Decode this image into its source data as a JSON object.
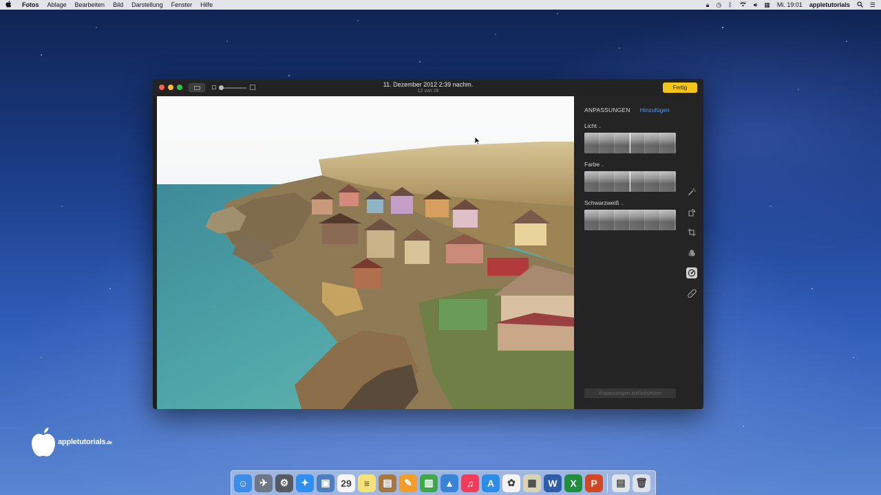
{
  "menubar": {
    "apple": "",
    "items": [
      "Fotos",
      "Ablage",
      "Bearbeiten",
      "Bild",
      "Darstellung",
      "Fenster",
      "Hilfe"
    ],
    "clock": "Mi. 19:01",
    "user": "appletutorials"
  },
  "window": {
    "title": "11. Dezember 2012 2:39 nachm.",
    "subtitle": "12 von 28",
    "done_label": "Fertig"
  },
  "panel": {
    "tab_adjust": "ANPASSUNGEN",
    "tab_add": "Hinzufügen",
    "sections": [
      {
        "label": "Licht",
        "marker": true
      },
      {
        "label": "Farbe",
        "marker": true
      },
      {
        "label": "Schwarzweiß",
        "marker": false
      }
    ],
    "reset_label": "Anpassungen zurücksetzen"
  },
  "tools": [
    "magic-wand-icon",
    "rotate-icon",
    "crop-icon",
    "filters-icon",
    "adjust-icon",
    "retouch-icon"
  ],
  "logo": {
    "text": "appletutorials",
    "suffix": ".de"
  },
  "dock": {
    "items": [
      {
        "name": "finder-icon",
        "color": "#3d8de8",
        "glyph": "☺"
      },
      {
        "name": "launchpad-icon",
        "color": "#6d7785",
        "glyph": "✈"
      },
      {
        "name": "system-preferences-icon",
        "color": "#555b63",
        "glyph": "⚙"
      },
      {
        "name": "safari-icon",
        "color": "#2e8ff0",
        "glyph": "✦"
      },
      {
        "name": "preview-icon",
        "color": "#4d7fbf",
        "glyph": "▣"
      },
      {
        "name": "calendar-icon",
        "color": "#f6f6f6",
        "glyph": "29"
      },
      {
        "name": "notes-icon",
        "color": "#f5e27a",
        "glyph": "≡"
      },
      {
        "name": "notebook-icon",
        "color": "#a5783f",
        "glyph": "▤"
      },
      {
        "name": "pages-icon",
        "color": "#f29d2b",
        "glyph": "✎"
      },
      {
        "name": "numbers-icon",
        "color": "#3ea84a",
        "glyph": "▥"
      },
      {
        "name": "keynote-icon",
        "color": "#3a84d8",
        "glyph": "▲"
      },
      {
        "name": "itunes-icon",
        "color": "#f23c5a",
        "glyph": "♫"
      },
      {
        "name": "app-store-icon",
        "color": "#2d8ce6",
        "glyph": "A"
      },
      {
        "name": "photos-icon",
        "color": "#f4f4f4",
        "glyph": "✿"
      },
      {
        "name": "image-capture-icon",
        "color": "#d8d3b5",
        "glyph": "▦"
      },
      {
        "name": "word-icon",
        "color": "#2f5ca6",
        "glyph": "W"
      },
      {
        "name": "excel-icon",
        "color": "#1f8f3e",
        "glyph": "X"
      },
      {
        "name": "powerpoint-icon",
        "color": "#d24726",
        "glyph": "P"
      },
      {
        "name": "documents-icon",
        "color": "#dfe3ea",
        "glyph": "▤"
      },
      {
        "name": "trash-icon",
        "color": "#dde2ea",
        "glyph": "🗑"
      }
    ]
  }
}
